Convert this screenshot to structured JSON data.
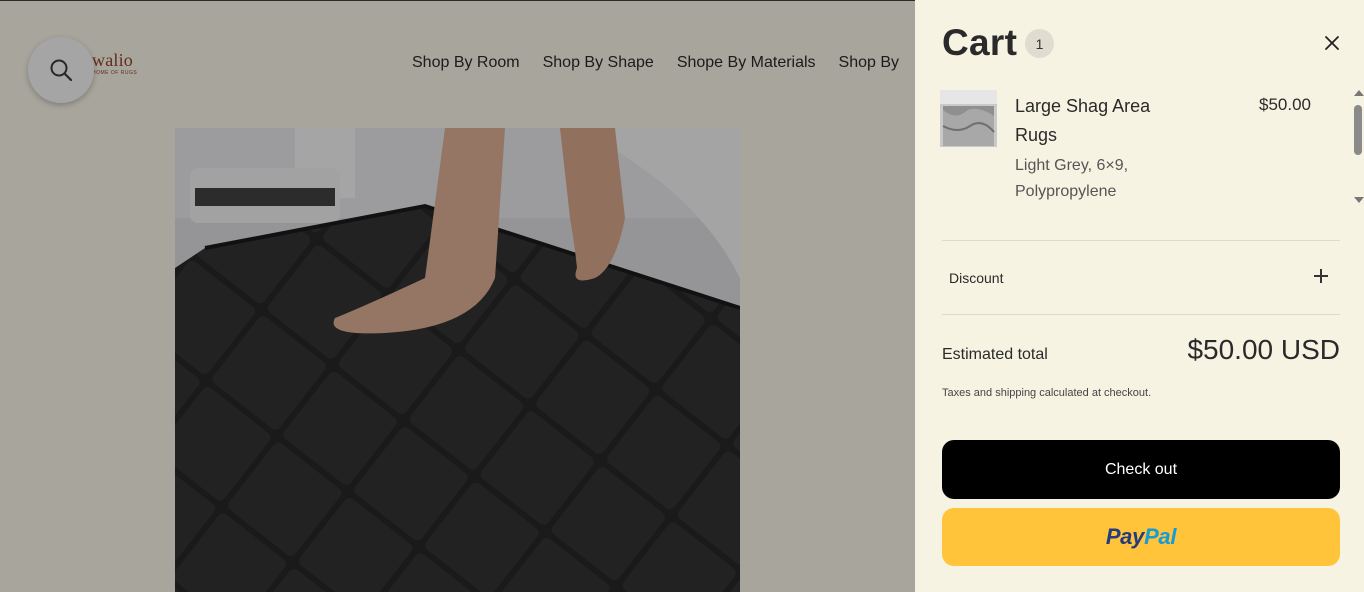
{
  "header": {
    "logo": {
      "name": "walio",
      "tagline": "HOME OF RUGS"
    },
    "search": {
      "icon": "search-icon"
    },
    "nav": [
      {
        "label": "Shop By Room"
      },
      {
        "label": "Shop By Shape"
      },
      {
        "label": "Shope By Materials"
      },
      {
        "label": "Shop By"
      }
    ]
  },
  "product": {
    "image": "black-bath-mat-photo"
  },
  "cart": {
    "title": "Cart",
    "count": "1",
    "close_icon": "close-icon",
    "items": [
      {
        "name": "Large Shag Area Rugs",
        "price": "$50.00",
        "variant": "Light Grey, 6×9, Polypropylene",
        "thumbnail": "grey-shag-rug-thumbnail"
      }
    ],
    "discount": {
      "label": "Discount",
      "icon": "plus-icon"
    },
    "estimated_total": {
      "label": "Estimated total",
      "value": "$50.00 USD"
    },
    "tax_note": "Taxes and shipping calculated at checkout.",
    "checkout_label": "Check out",
    "paypal": {
      "part1": "Pay",
      "part2": "Pal"
    }
  },
  "colors": {
    "drawer_bg": "#f7f3e3",
    "checkout_bg": "#000000",
    "paypal_bg": "#ffc439",
    "paypal_dark": "#253b80",
    "paypal_light": "#179bd7"
  }
}
